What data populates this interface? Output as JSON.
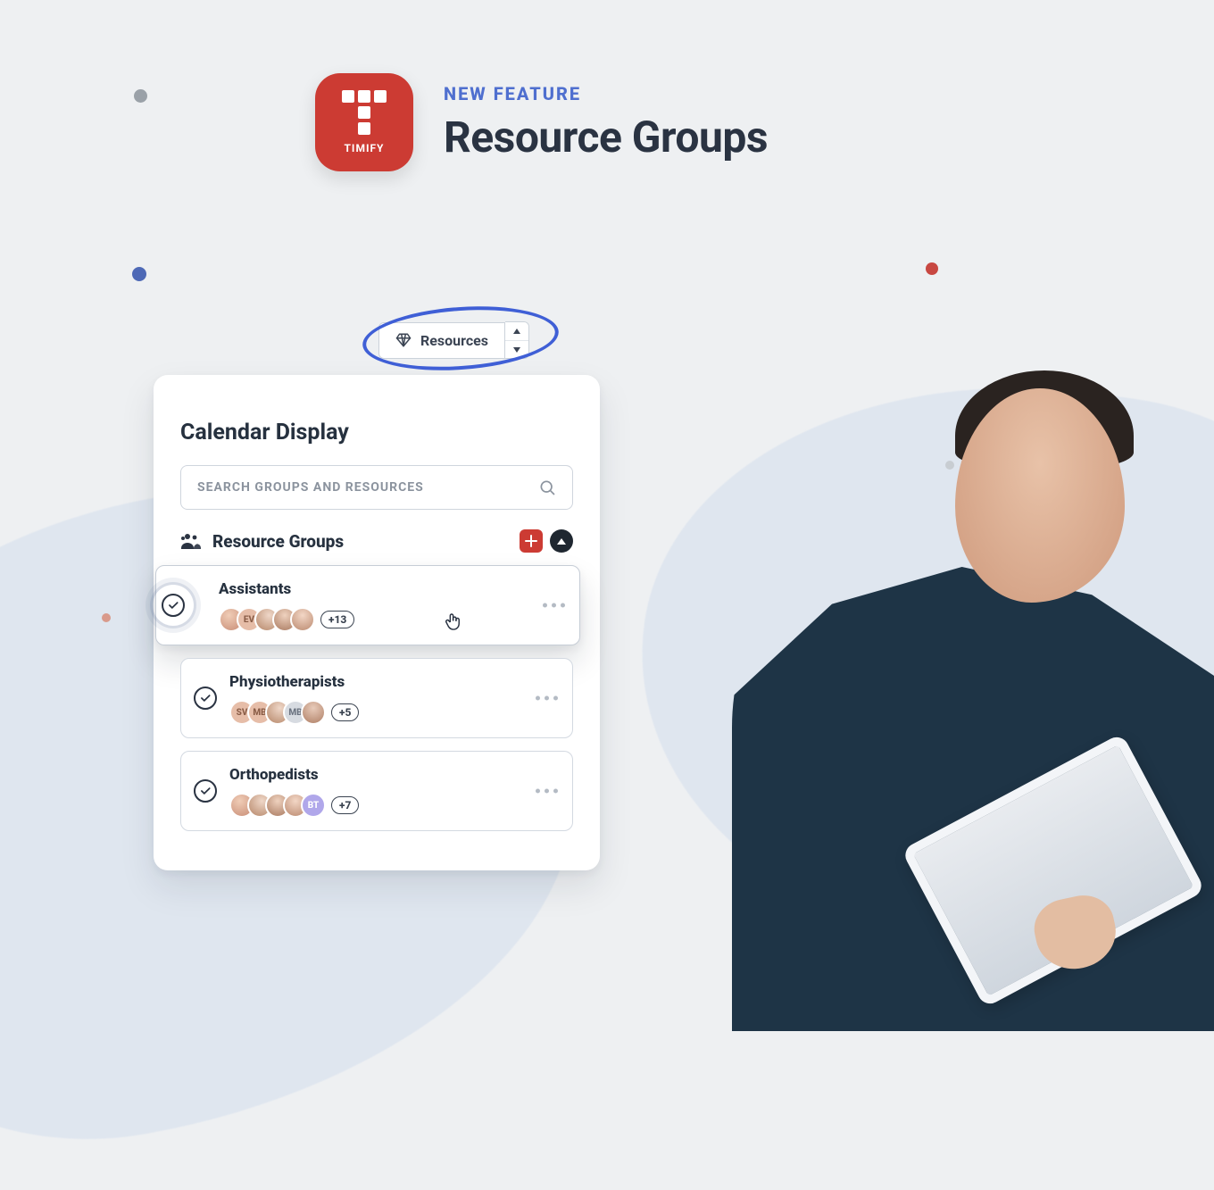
{
  "brand": {
    "name": "TIMIFY"
  },
  "header": {
    "kicker": "NEW FEATURE",
    "title": "Resource Groups"
  },
  "toolbar": {
    "resources_label": "Resources"
  },
  "panel": {
    "title": "Calendar Display",
    "search_placeholder": "SEARCH GROUPS AND RESOURCES",
    "section_title": "Resource Groups"
  },
  "groups": [
    {
      "name": "Assistants",
      "more": "+13",
      "initials": [
        "",
        "EV",
        "",
        "",
        ""
      ]
    },
    {
      "name": "Physiotherapists",
      "more": "+5",
      "initials": [
        "SV",
        "MB",
        "",
        "MB",
        ""
      ]
    },
    {
      "name": "Orthopedists",
      "more": "+7",
      "initials": [
        "",
        "",
        "",
        "",
        "BT"
      ]
    }
  ]
}
